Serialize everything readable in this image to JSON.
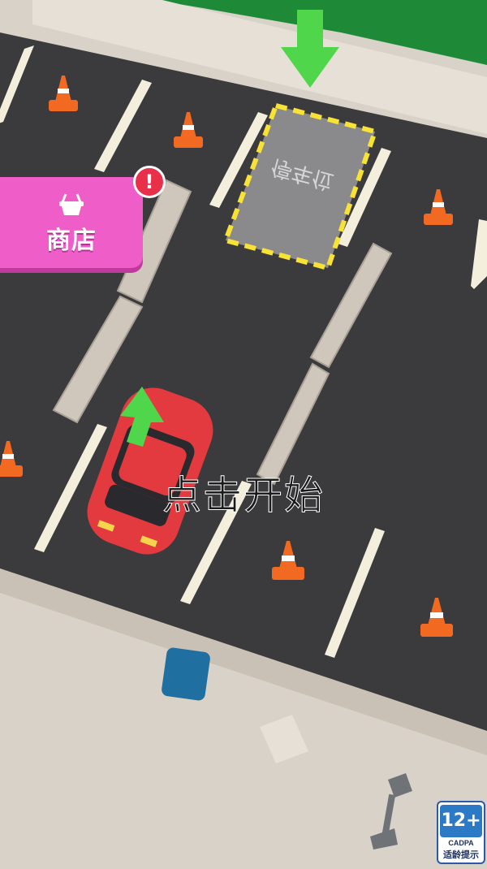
{
  "shop": {
    "label": "商店",
    "badge": "!"
  },
  "parking_spot": {
    "label": "停车位"
  },
  "start_prompt": "点击开始",
  "age_rating": {
    "rating": "12+",
    "org": "CADPA",
    "tip": "适龄提示"
  },
  "colors": {
    "road": "#3b3b3d",
    "curb": "#d9d2c8",
    "car": "#e23a3f",
    "arrow": "#4fd64a",
    "spot_border": "#f7e235",
    "shop": "#ef5ec8"
  }
}
